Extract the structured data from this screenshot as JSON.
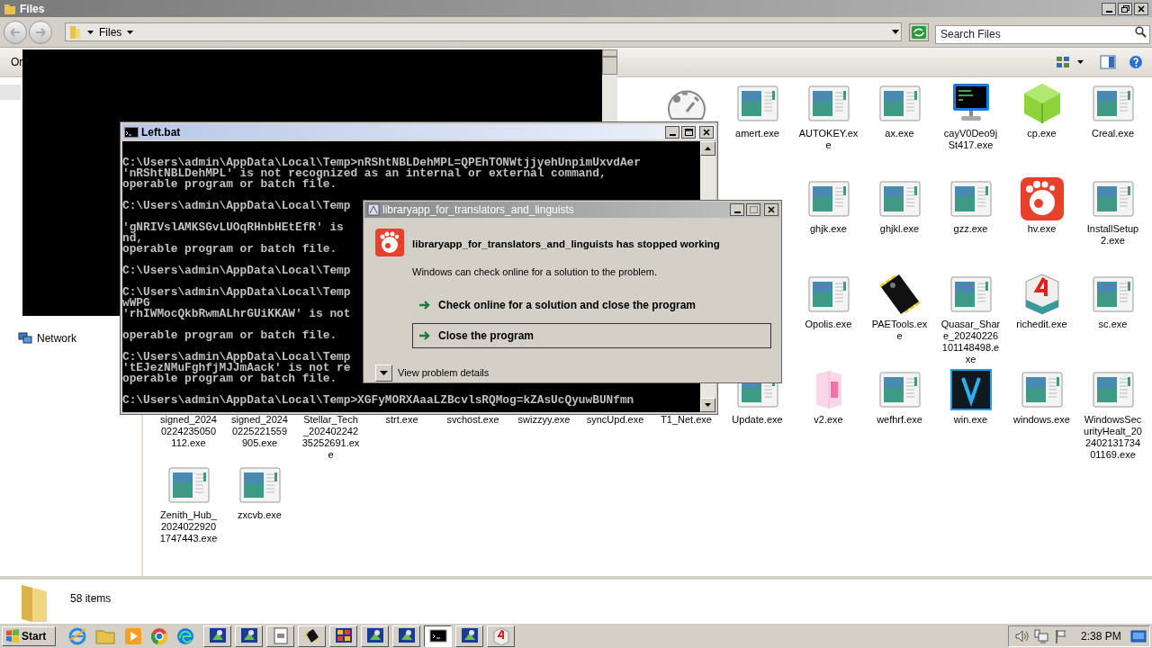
{
  "explorer": {
    "title": "Files",
    "breadcrumb": "Files",
    "search_placeholder": "Search Files",
    "toolbar_label": "Or",
    "nav": [
      {
        "label": "Network"
      }
    ],
    "rows": [
      [
        "",
        "",
        "",
        "",
        "",
        "",
        "",
        {
          "kind": "gauge"
        },
        {
          "kind": "app",
          "label": "amert.exe"
        },
        {
          "kind": "app",
          "label": "AUTOKEY.exe"
        },
        {
          "kind": "app",
          "label": "ax.exe"
        },
        {
          "kind": "terminal",
          "label": "cayV0Deo9jSt417.exe"
        },
        {
          "kind": "cube",
          "label": "cp.exe"
        },
        {
          "kind": "app",
          "label": "Creal.exe"
        }
      ],
      [
        "",
        "",
        "",
        "",
        "",
        "",
        "",
        "",
        "",
        {
          "kind": "app",
          "label": "ghjk.exe"
        },
        {
          "kind": "app",
          "label": "ghjkl.exe"
        },
        {
          "kind": "app",
          "label": "gzz.exe"
        },
        {
          "kind": "gallery",
          "label": "hv.exe"
        },
        {
          "kind": "app",
          "label": "InstallSetup2.exe"
        }
      ],
      [
        "",
        "",
        "",
        "",
        "",
        "",
        "",
        "",
        "",
        {
          "kind": "app",
          "label": "Opolis.exe"
        },
        {
          "kind": "chip",
          "label": "PAETools.exe"
        },
        {
          "kind": "app",
          "label": "Quasar_Share_20240226101148498.exe"
        },
        {
          "kind": "dice",
          "label": "richedit.exe"
        },
        {
          "kind": "app",
          "label": "sc.exe"
        }
      ],
      [
        {
          "kind": "covered",
          "label": "signed_20240224235050112.exe"
        },
        {
          "kind": "covered",
          "label": "signed_20240225221559905.exe"
        },
        {
          "kind": "covered",
          "label": "Stellar_Tech_20240224235252691.exe"
        },
        {
          "kind": "covered",
          "label": "strt.exe"
        },
        {
          "kind": "covered",
          "label": "svchost.exe"
        },
        {
          "kind": "covered",
          "label": "swizzyy.exe"
        },
        {
          "kind": "covered",
          "label": "syncUpd.exe"
        },
        {
          "kind": "covered",
          "label": "T1_Net.exe"
        },
        {
          "kind": "app",
          "label": "Update.exe"
        },
        {
          "kind": "package",
          "label": "v2.exe"
        },
        {
          "kind": "app",
          "label": "wefhrf.exe"
        },
        {
          "kind": "vlogo",
          "label": "win.exe"
        },
        {
          "kind": "app",
          "label": "windows.exe"
        },
        {
          "kind": "app",
          "label": "WindowsSecurityHealt_20240213173401169.exe"
        }
      ],
      [
        {
          "kind": "app",
          "label": "Zenith_Hub_20240229201747443.exe"
        },
        {
          "kind": "app",
          "label": "zxcvb.exe"
        }
      ]
    ],
    "status": "58 items"
  },
  "console": {
    "title": "Left.bat",
    "blocks": [
      [
        "C:\\Users\\admin\\AppData\\Local\\Temp>nRShtNBLDehMPL=QPEhTONWtjjyehUnpimUxvdAer",
        "'nRShtNBLDehMPL' is not recognized as an internal or external command,",
        "operable program or batch file."
      ],
      [
        "C:\\Users\\admin\\AppData\\Local\\Temp"
      ],
      [
        "'gNRIVslAMKSGvLUOqRHnbHEtEfR' is",
        "nd,",
        "operable program or batch file."
      ],
      [
        "C:\\Users\\admin\\AppData\\Local\\Temp"
      ],
      [
        "C:\\Users\\admin\\AppData\\Local\\Temp",
        "wWPG",
        "'rhIWMocQkbRwmALhrGUiKKAW' is not"
      ],
      [
        "operable program or batch file."
      ],
      [
        "C:\\Users\\admin\\AppData\\Local\\Temp",
        "'tEJezNMuFghfjMJJmAack' is not re",
        "operable program or batch file."
      ],
      [
        "C:\\Users\\admin\\AppData\\Local\\Temp>XGFyMORXAaaLZBcvlsRQMog=kZAsUcQyuwBUNfmn"
      ]
    ]
  },
  "dialog": {
    "title": "libraryapp_for_translators_and_linguists",
    "heading": "libraryapp_for_translators_and_linguists has stopped working",
    "message": "Windows can check online for a solution to the problem.",
    "options": [
      {
        "label": "Check online for a solution and close the program",
        "selected": false
      },
      {
        "label": "Close the program",
        "selected": true
      }
    ],
    "details_label": "View problem details"
  },
  "taskbar": {
    "start": "Start",
    "pinned": [
      {
        "kind": "ie"
      },
      {
        "kind": "folder"
      },
      {
        "kind": "media"
      },
      {
        "kind": "chrome"
      },
      {
        "kind": "edge"
      }
    ],
    "tasks": [
      {
        "kind": "setup",
        "selected": false
      },
      {
        "kind": "setup",
        "selected": false
      },
      {
        "kind": "doc",
        "selected": false
      },
      {
        "kind": "chip",
        "selected": false
      },
      {
        "kind": "tiles",
        "selected": false
      },
      {
        "kind": "setup",
        "selected": false
      },
      {
        "kind": "setup",
        "selected": false
      },
      {
        "kind": "console",
        "selected": true
      },
      {
        "kind": "setup",
        "selected": false
      },
      {
        "kind": "dice",
        "selected": false
      }
    ],
    "clock": "2:38 PM"
  }
}
